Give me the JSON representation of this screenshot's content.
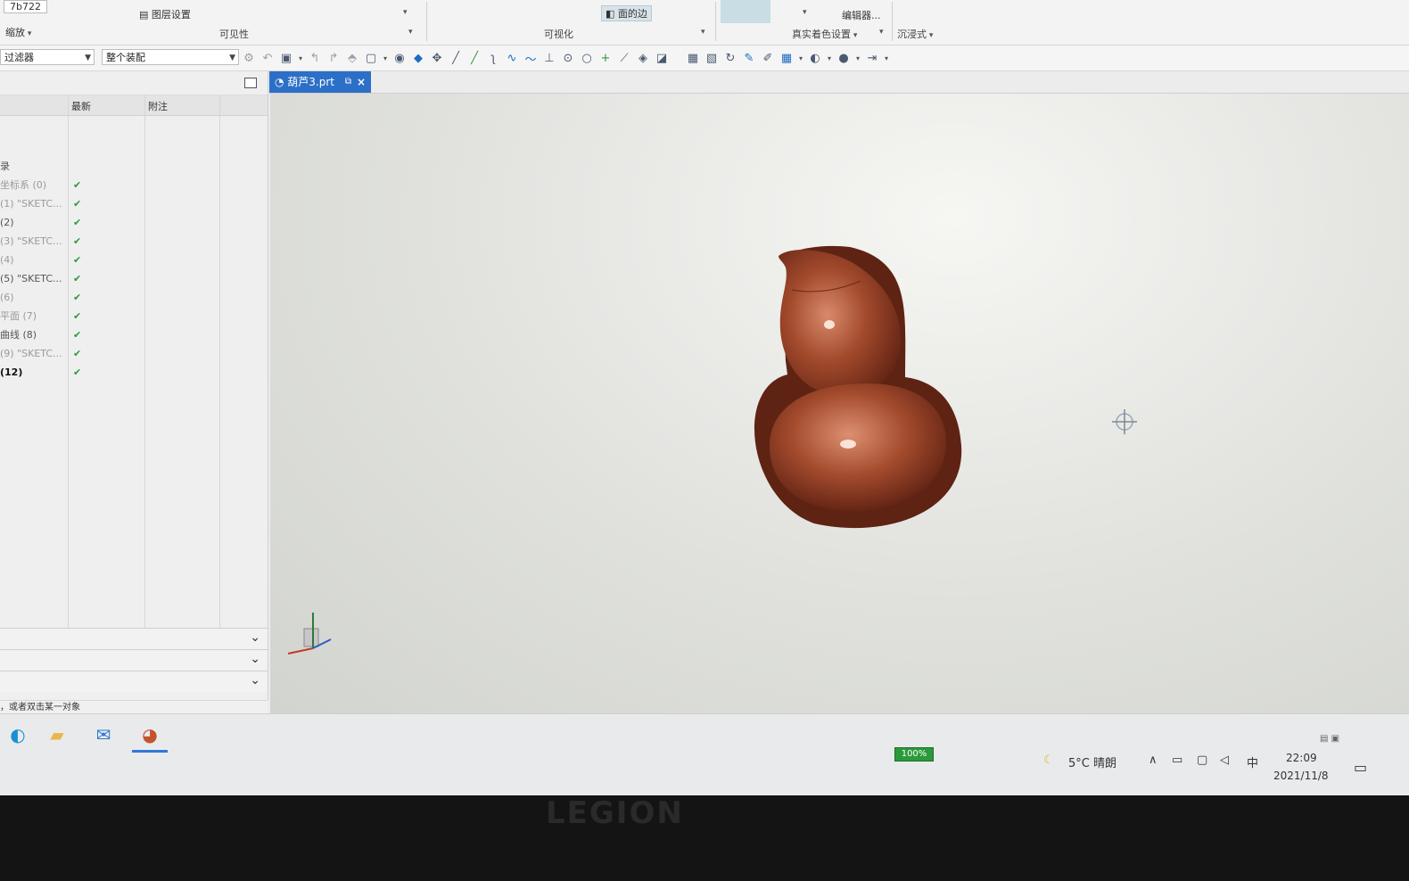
{
  "ribbon": {
    "top_left_value": "7b722",
    "layer_settings": "图层设置",
    "zoom": "缩放",
    "visibility_group": "可见性",
    "visualization_group": "可视化",
    "faces_edges": "面的边",
    "true_shading_settings": "真实着色设置",
    "editor": "编辑器...",
    "immersive": "沉浸式"
  },
  "toolbar": {
    "filter_combo": "过滤器",
    "assembly_combo": "整个装配"
  },
  "navigator": {
    "columns": [
      "最新",
      "附注"
    ],
    "rows": [
      {
        "name": "",
        "check": false,
        "style": "normal"
      },
      {
        "name": "录",
        "check": false,
        "style": "normal"
      },
      {
        "name": "坐标系 (0)",
        "check": true,
        "style": "dim"
      },
      {
        "name": "(1) \"SKETC...",
        "check": true,
        "style": "dim"
      },
      {
        "name": "(2)",
        "check": true,
        "style": "normal"
      },
      {
        "name": "(3) \"SKETC...",
        "check": true,
        "style": "dim"
      },
      {
        "name": "(4)",
        "check": true,
        "style": "dim"
      },
      {
        "name": "(5) \"SKETC...",
        "check": true,
        "style": "normal"
      },
      {
        "name": "(6)",
        "check": true,
        "style": "dim"
      },
      {
        "name": "平面 (7)",
        "check": true,
        "style": "dim"
      },
      {
        "name": "曲线 (8)",
        "check": true,
        "style": "normal"
      },
      {
        "name": "(9) \"SKETC...",
        "check": true,
        "style": "dim"
      },
      {
        "name": "(12)",
        "check": true,
        "style": "bold"
      }
    ]
  },
  "status_text": "，或者双击某一对象",
  "tab": {
    "label": "葫芦3.prt",
    "pin": "⧉",
    "close": "×"
  },
  "model": {
    "body_color": "#8c3a22",
    "highlight_color": "#e7a78c"
  },
  "taskbar": {
    "battery": "100%",
    "weather": "5°C 晴朗",
    "ime": "中",
    "time": "22:09",
    "date": "2021/11/8"
  },
  "laptop_logo": "LEGION"
}
